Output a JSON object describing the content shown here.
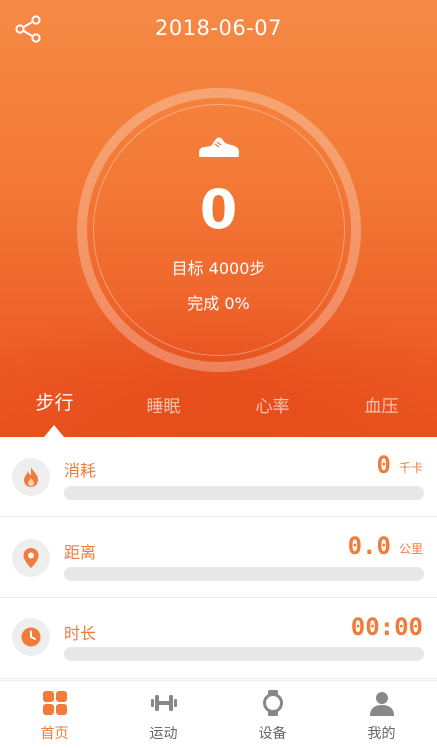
{
  "header": {
    "date": "2018-06-07",
    "share_icon": "share-icon"
  },
  "summary": {
    "shoe_icon": "shoe-icon",
    "steps": "0",
    "target_text": "目标 4000步",
    "complete_text": "完成 0%"
  },
  "tabs": [
    {
      "label": "步行",
      "active": true
    },
    {
      "label": "睡眠",
      "active": false
    },
    {
      "label": "心率",
      "active": false
    },
    {
      "label": "血压",
      "active": false
    }
  ],
  "metrics": [
    {
      "label": "消耗",
      "value": "0",
      "unit": "千卡",
      "icon": "flame-icon",
      "progress": 0
    },
    {
      "label": "距离",
      "value": "0.0",
      "unit": "公里",
      "icon": "location-pin-icon",
      "progress": 0
    },
    {
      "label": "时长",
      "value": "00:00",
      "unit": "",
      "icon": "clock-icon",
      "progress": 0
    }
  ],
  "nav": [
    {
      "label": "首页",
      "icon": "home-grid-icon",
      "active": true
    },
    {
      "label": "运动",
      "icon": "dumbbell-icon",
      "active": false
    },
    {
      "label": "设备",
      "icon": "watch-icon",
      "active": false
    },
    {
      "label": "我的",
      "icon": "profile-icon",
      "active": false
    }
  ],
  "colors": {
    "accent": "#f07b3a",
    "hero_top": "#f58a45",
    "hero_bottom": "#e9521f",
    "track": "#e8e8e8",
    "inactive_nav": "#666666"
  }
}
